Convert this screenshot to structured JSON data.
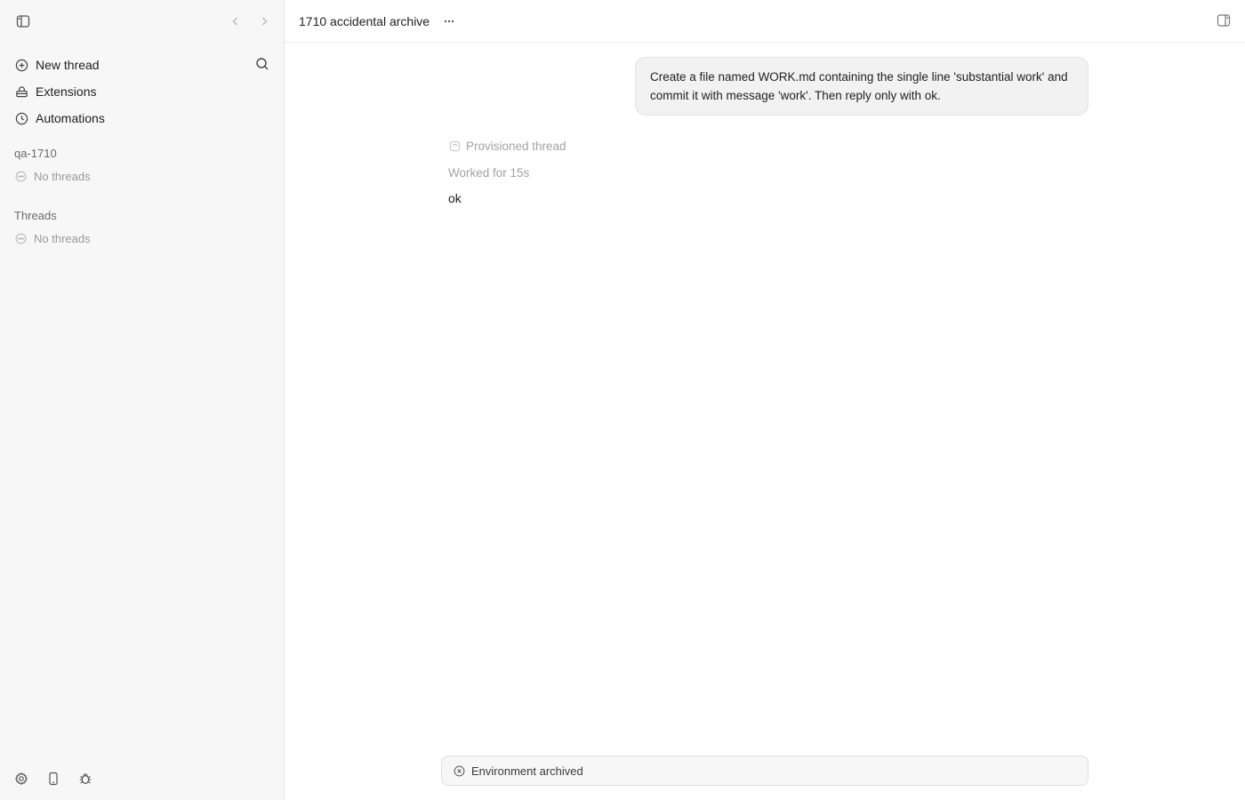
{
  "sidebar": {
    "toggle_icon": "sidebar-toggle-icon",
    "back_icon": "chevron-left-icon",
    "forward_icon": "chevron-right-icon",
    "nav": [
      {
        "label": "New thread",
        "icon": "plus-circle-icon"
      },
      {
        "label": "Extensions",
        "icon": "extensions-icon"
      },
      {
        "label": "Automations",
        "icon": "clock-icon"
      }
    ],
    "search_icon": "search-icon",
    "sections": [
      {
        "label": "qa-1710",
        "empty_text": "No threads"
      },
      {
        "label": "Threads",
        "empty_text": "No threads"
      }
    ],
    "bottom_icons": [
      "settings-icon",
      "mobile-icon",
      "bug-icon"
    ]
  },
  "header": {
    "title": "1710 accidental archive",
    "more_icon": "more-horizontal-icon",
    "panel_icon": "right-panel-icon"
  },
  "conversation": {
    "user_message": "Create a file named WORK.md containing the single line 'substantial work' and commit it with message 'work'. Then reply only with ok.",
    "provisioned_label": "Provisioned thread",
    "worked_label": "Worked for 15s",
    "assistant_reply": "ok"
  },
  "footer": {
    "status_text": "Environment archived",
    "status_icon": "x-circle-icon"
  }
}
